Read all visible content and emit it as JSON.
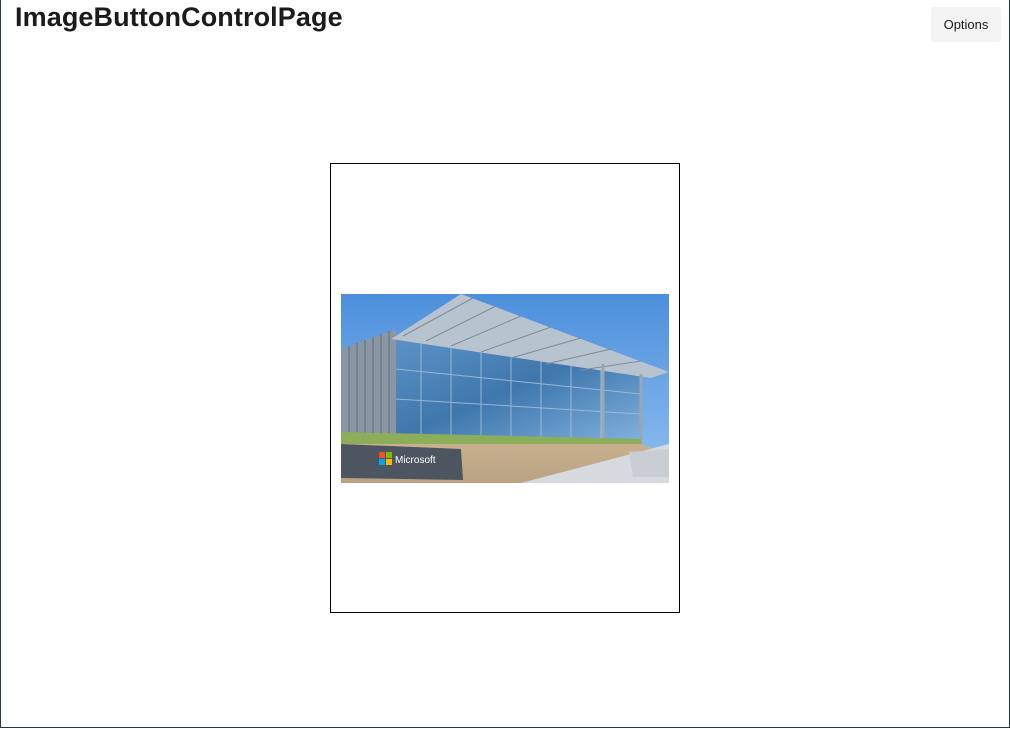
{
  "page": {
    "title": "ImageButtonControlPage"
  },
  "toolbar": {
    "options_label": "Options"
  },
  "image_button": {
    "image_description_icon": "building-photo",
    "sign_text": "Microsoft"
  },
  "colors": {
    "sky": "#5b9be0",
    "glass": "#4a7fb5",
    "border": "#000000",
    "options_bg": "#f3f3f3"
  }
}
